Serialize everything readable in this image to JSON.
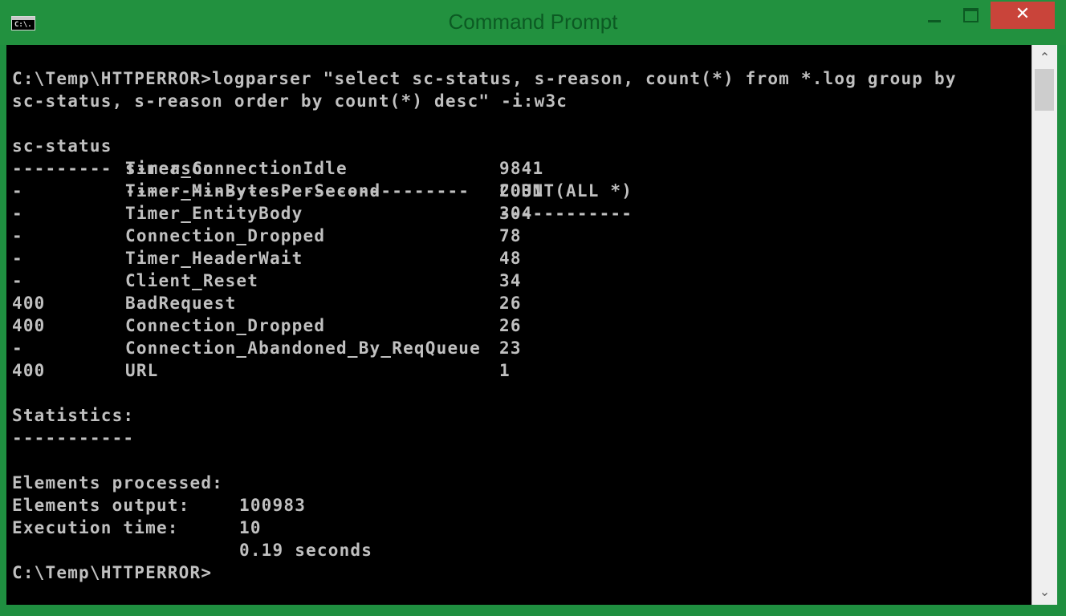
{
  "window": {
    "title": "Command Prompt",
    "icon_text": "C:\\.",
    "controls": {
      "minimize": "minimize",
      "maximize": "maximize",
      "close": "✕"
    }
  },
  "console": {
    "command_line_1": "C:\\Temp\\HTTPERROR>logparser \"select sc-status, s-reason, count(*) from *.log group by",
    "command_line_2": "sc-status, s-reason order by count(*) desc\" -i:w3c",
    "table": {
      "headers": {
        "status": "sc-status",
        "reason": "s-reason",
        "count": "COUNT(ALL *)"
      },
      "separators": {
        "status": "---------",
        "reason": "-------------------------------",
        "count": "------------"
      },
      "rows": [
        {
          "status": "-",
          "reason": "Timer_ConnectionIdle",
          "count": "9841"
        },
        {
          "status": "-",
          "reason": "Timer_MinBytesPerSecond",
          "count": "2031"
        },
        {
          "status": "-",
          "reason": "Timer_EntityBody",
          "count": "304"
        },
        {
          "status": "-",
          "reason": "Connection_Dropped",
          "count": "78"
        },
        {
          "status": "-",
          "reason": "Timer_HeaderWait",
          "count": "48"
        },
        {
          "status": "-",
          "reason": "Client_Reset",
          "count": "34"
        },
        {
          "status": "400",
          "reason": "BadRequest",
          "count": "26"
        },
        {
          "status": "400",
          "reason": "Connection_Dropped",
          "count": "26"
        },
        {
          "status": "-",
          "reason": "Connection_Abandoned_By_ReqQueue",
          "count": "23"
        },
        {
          "status": "400",
          "reason": "URL",
          "count": "1"
        }
      ]
    },
    "statistics": {
      "heading": "Statistics:",
      "underline": "-----------",
      "elements_processed_label": "Elements processed:",
      "elements_processed_value": "100983",
      "elements_output_label": "Elements output:",
      "elements_output_value": "10",
      "execution_time_label": "Execution time:",
      "execution_time_value": "0.19 seconds"
    },
    "prompt": "C:\\Temp\\HTTPERROR>"
  },
  "colors": {
    "titlebar": "#22913f",
    "title_text": "#0c5a23",
    "close_button": "#c9443a",
    "console_bg": "#000000",
    "console_text": "#c0c0c0"
  }
}
